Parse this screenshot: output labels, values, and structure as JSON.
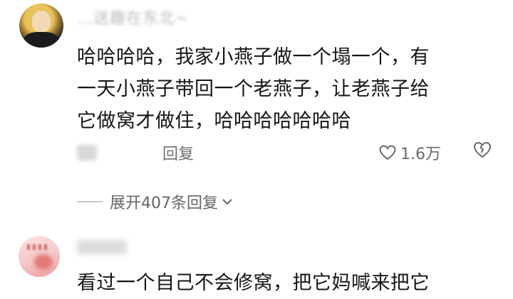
{
  "comment1": {
    "username": "…送趣在东北~",
    "text_lines": [
      "哈哈哈哈，我家小燕子做一个塌一个，有",
      "一天小燕子带回一个老燕子，让老燕子给",
      "它做窝才做住，哈哈哈哈哈哈哈"
    ],
    "reply_label": "回复",
    "like_count": "1.6万",
    "expand_label": "展开407条回复"
  },
  "comment2": {
    "text_partial": "看过一个自己不会修窝，把它妈喊来把它"
  },
  "icons": [
    "heart-outline-icon",
    "broken-heart-icon",
    "chevron-down-icon"
  ]
}
